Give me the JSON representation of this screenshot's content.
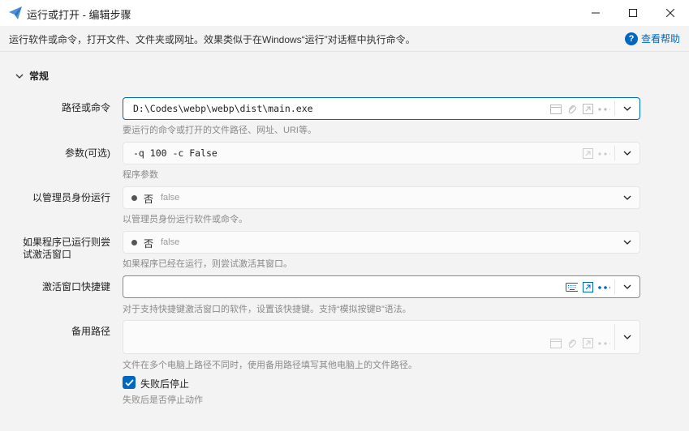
{
  "window": {
    "title": "运行或打开 - 编辑步骤",
    "description": "运行软件或命令，打开文件、文件夹或网址。效果类似于在Windows“运行”对话框中执行命令。",
    "help_label": "查看帮助"
  },
  "section": {
    "title": "常规"
  },
  "fields": {
    "path": {
      "label": "路径或命令",
      "value": "D:\\Codes\\webp\\webp\\dist\\main.exe",
      "hint": "要运行的命令或打开的文件路径、网址、URI等。"
    },
    "args": {
      "label": "参数(可选)",
      "value": "-q 100 -c False",
      "hint": "程序参数"
    },
    "admin": {
      "label": "以管理员身份运行",
      "display": "否",
      "raw": "false",
      "hint": "以管理员身份运行软件或命令。"
    },
    "activate": {
      "label_line1": "如果程序已运行则尝",
      "label_line2": "试激活窗口",
      "display": "否",
      "raw": "false",
      "hint": "如果程序已经在运行，则尝试激活其窗口。"
    },
    "hotkey": {
      "label": "激活窗口快捷键",
      "value": "",
      "hint": "对于支持快捷键激活窗口的软件，设置该快捷键。支持“模拟按键B”语法。"
    },
    "backup": {
      "label": "备用路径",
      "value": "",
      "hint": "文件在多个电脑上路径不同时，使用备用路径填写其他电脑上的文件路径。"
    }
  },
  "stop_on_fail": {
    "label": "失败后停止",
    "checked": true,
    "hint": "失败后是否停止动作"
  },
  "colors": {
    "accent": "#0067c0",
    "background": "#f3f3f3"
  }
}
